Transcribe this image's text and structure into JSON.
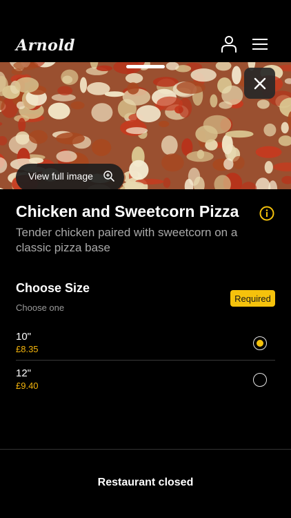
{
  "header": {
    "logo_text": "Arnold",
    "user_icon": "user-icon",
    "menu_icon": "hamburger-menu-icon"
  },
  "hero": {
    "view_full_label": "View full image",
    "zoom_icon": "zoom-in-icon",
    "close_icon": "close-icon"
  },
  "product": {
    "title": "Chicken and Sweetcorn Pizza",
    "description": "Tender chicken paired with sweetcorn on a classic pizza base",
    "info_icon": "info-icon"
  },
  "size_section": {
    "title": "Choose Size",
    "subtitle": "Choose one",
    "badge": "Required",
    "options": [
      {
        "label": "10\"",
        "price": "£8.35",
        "selected": true
      },
      {
        "label": "12\"",
        "price": "£9.40",
        "selected": false
      }
    ]
  },
  "footer": {
    "status": "Restaurant closed"
  },
  "colors": {
    "accent": "#f5c20c",
    "price": "#f5b50c",
    "background": "#000000"
  }
}
